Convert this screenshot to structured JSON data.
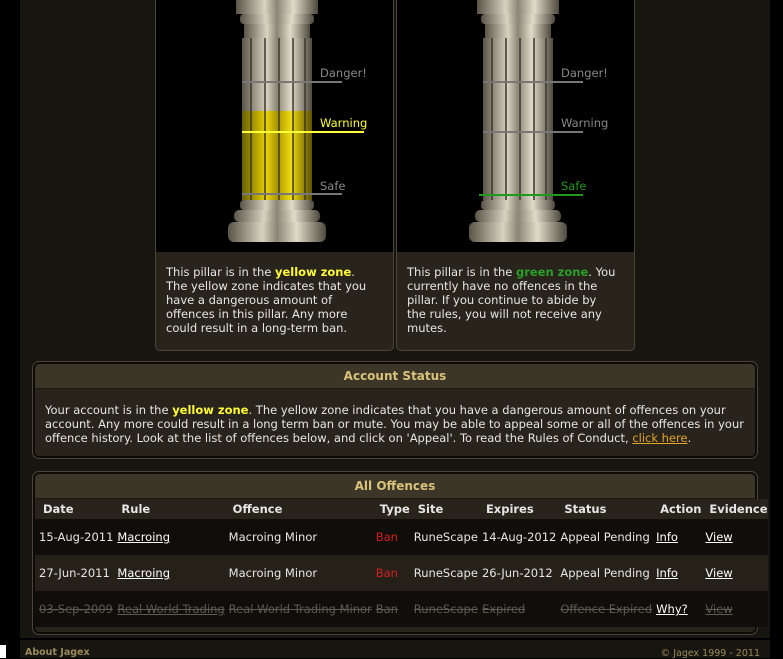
{
  "pillars": [
    {
      "zone_color": "#ffff33",
      "fill_level": 0.55,
      "active_level": "Warning",
      "levels": {
        "danger": "Danger!",
        "warning": "Warning",
        "safe": "Safe"
      },
      "desc_prefix": "This pillar is in the ",
      "desc_zone": "yellow zone",
      "desc_suffix": ". The yellow zone indicates that you have a dangerous amount of offences in this pillar. Any more could result in a long-term ban."
    },
    {
      "zone_color": "#1f9a1f",
      "fill_level": 0,
      "active_level": "Safe",
      "levels": {
        "danger": "Danger!",
        "warning": "Warning",
        "safe": "Safe"
      },
      "desc_prefix": "This pillar is in the ",
      "desc_zone": "green zone",
      "desc_suffix": ". You currently have no offences in the pillar. If you continue to abide by the rules, you will not receive any mutes."
    }
  ],
  "account_status": {
    "title": "Account Status",
    "text_prefix": "Your account is in the ",
    "zone": "yellow zone",
    "text_main": ". The yellow zone indicates that you have a dangerous amount of offences on your account. Any more could result in a long term ban or mute. You may be able to appeal some or all of the offences in your offence history. Look at the list of offences below, and click on 'Appeal'. To read the Rules of Conduct, ",
    "link": "click here",
    "text_end": "."
  },
  "offences": {
    "title": "All Offences",
    "columns": [
      "Date",
      "Rule",
      "Offence",
      "Type",
      "Site",
      "Expires",
      "Status",
      "Action",
      "Evidence"
    ],
    "rows": [
      {
        "date": "15-Aug-2011",
        "rule": "Macroing",
        "offence": "Macroing Minor",
        "type": "Ban",
        "site": "RuneScape",
        "expires": "14-Aug-2012",
        "status": "Appeal Pending",
        "action": "Info",
        "evidence": "View"
      },
      {
        "date": "27-Jun-2011",
        "rule": "Macroing",
        "offence": "Macroing Minor",
        "type": "Ban",
        "site": "RuneScape",
        "expires": "26-Jun-2012",
        "status": "Appeal Pending",
        "action": "Info",
        "evidence": "View"
      },
      {
        "date": "03-Sep-2009",
        "rule": "Real World Trading",
        "offence": "Real World Trading Minor",
        "type": "Ban",
        "site": "RuneScape",
        "expires": "Expired",
        "status": "Offence Expired",
        "action": "Why?",
        "evidence": "View"
      }
    ]
  },
  "footer": {
    "about": "About Jagex",
    "copyright": "© Jagex 1999 - 2011"
  }
}
